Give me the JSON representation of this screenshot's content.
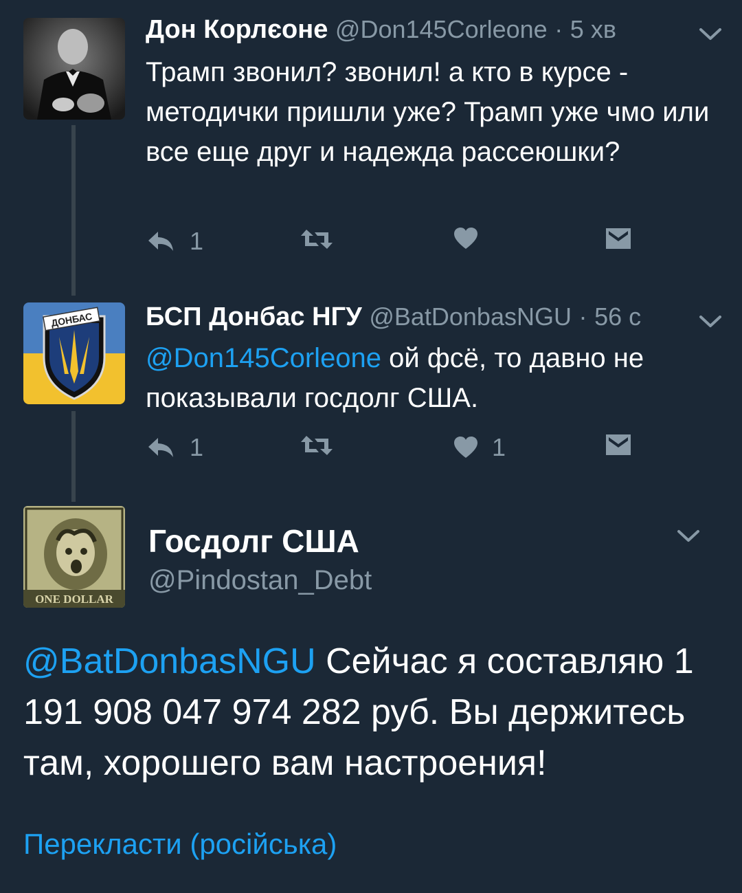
{
  "tweets": [
    {
      "name": "Дон Корлєоне",
      "handle": "@Don145Corleone",
      "time": "5 хв",
      "text": "Трамп звонил? звонил! а кто в курсе - методички пришли уже? Трамп уже чмо или все еще друг и надежда рассеюшки?",
      "reply_count": "1",
      "retweet_count": "",
      "like_count": ""
    },
    {
      "name": "БСП Донбас НГУ",
      "handle": "@BatDonbasNGU",
      "time": "56 с",
      "mention": "@Don145Corleone",
      "text": " ой фсё, то давно не показывали госдолг США.",
      "reply_count": "1",
      "retweet_count": "",
      "like_count": "1",
      "avatar_badge": "ДОНБАС"
    }
  ],
  "main_tweet": {
    "name": "Госдолг США",
    "handle": "@Pindostan_Debt",
    "mention": "@BatDonbasNGU",
    "text": " Сейчас я составляю 1 191 908 047 974 282 руб. Вы держитесь там, хорошего вам настроения!",
    "translate_label": "Перекласти (російська)",
    "avatar_banner": "ONE DOLLAR"
  },
  "colors": {
    "background": "#1b2836",
    "accent": "#1da1f2",
    "muted": "#8899a6",
    "thread_line": "#38444d"
  }
}
